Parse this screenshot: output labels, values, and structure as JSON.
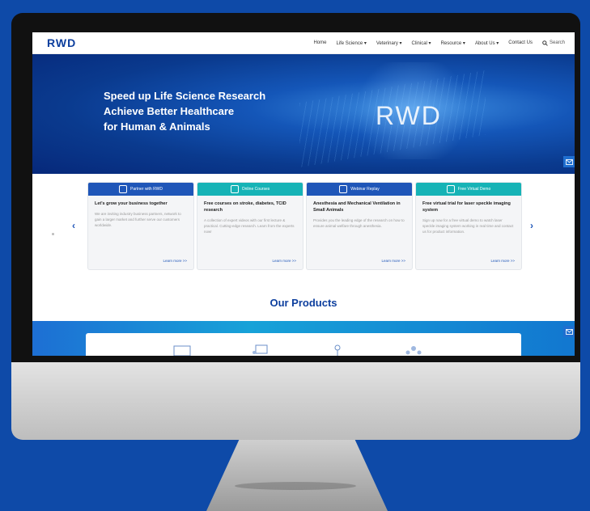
{
  "nav": {
    "logo": "RWD",
    "items": [
      "Home",
      "Life Science ▾",
      "Veterinary ▾",
      "Clinical ▾",
      "Resource ▾",
      "About Us ▾",
      "Contact Us"
    ],
    "search_label": "Search"
  },
  "hero": {
    "line1": "Speed up Life Science Research",
    "line2": "Achieve Better Healthcare",
    "line3": "for Human & Animals",
    "watermark": "RWD"
  },
  "cards": [
    {
      "header": "Partner with RWD",
      "title": "Let's grow your business together",
      "text": "We are inviting industry business partners, network to gain a larger market and further serve our customers worldwide.",
      "link": "Learn more >>",
      "color": "#1f56b8"
    },
    {
      "header": "Online Courses",
      "title": "Free courses on stroke, diabetes, TCID research",
      "text": "A collection of expert videos with our first lecture & practical. Cutting-edge research. Learn from the experts now!",
      "link": "Learn more >>",
      "color": "#16b3b6"
    },
    {
      "header": "Webinar Replay",
      "title": "Anesthesia and Mechanical Ventilation in Small Animals",
      "text": "Provides you the leading edge of the research on how to ensure animal welfare through anesthesia.",
      "link": "Learn more >>",
      "color": "#1f56b8"
    },
    {
      "header": "Free Virtual Demo",
      "title": "Free virtual trial for laser speckle imaging system",
      "text": "Sign up now for a free virtual demo to watch laser speckle imaging system working in real time and contact us for product information.",
      "link": "Learn more >>",
      "color": "#16b3b6"
    }
  ],
  "products_title": "Our Products",
  "colors": {
    "background": "#0e4aa8",
    "brand": "#0d3f9e",
    "teal": "#16b3b6"
  }
}
